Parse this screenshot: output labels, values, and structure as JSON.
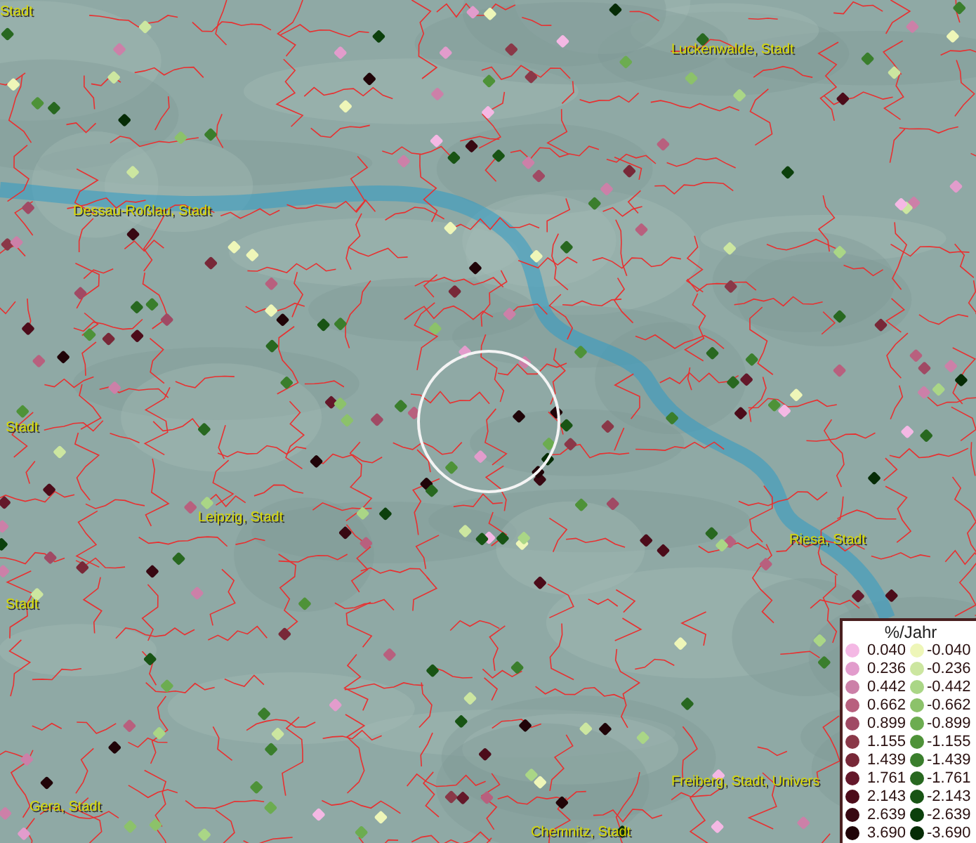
{
  "map": {
    "place_labels": [
      {
        "text": "Stadt"
      },
      {
        "text": "Luckenwalde, Stadt"
      },
      {
        "text": "Dessau-Roßlau, Stadt"
      },
      {
        "text": "Stadt"
      },
      {
        "text": "Leipzig, Stadt"
      },
      {
        "text": "Riesa, Stadt"
      },
      {
        "text": "Stadt"
      },
      {
        "text": "Gera, Stadt"
      },
      {
        "text": "Freiberg, Stadt, Univers"
      },
      {
        "text": "Chemnitz, Stadt"
      }
    ]
  },
  "legend": {
    "title": "%/Jahr",
    "rows": [
      {
        "left": {
          "value": "0.040",
          "color": "#f4b8e4"
        },
        "right": {
          "value": "-0.040",
          "color": "#eef6b8"
        }
      },
      {
        "left": {
          "value": "0.236",
          "color": "#e29ccc"
        },
        "right": {
          "value": "-0.236",
          "color": "#cce6a0"
        }
      },
      {
        "left": {
          "value": "0.442",
          "color": "#cc80a8"
        },
        "right": {
          "value": "-0.442",
          "color": "#aad686"
        }
      },
      {
        "left": {
          "value": "0.662",
          "color": "#b8607e"
        },
        "right": {
          "value": "-0.662",
          "color": "#8cc26a"
        }
      },
      {
        "left": {
          "value": "0.899",
          "color": "#a04a64"
        },
        "right": {
          "value": "-0.899",
          "color": "#6cac50"
        }
      },
      {
        "left": {
          "value": "1.155",
          "color": "#8a3848"
        },
        "right": {
          "value": "-1.155",
          "color": "#4e9238"
        }
      },
      {
        "left": {
          "value": "1.439",
          "color": "#782838"
        },
        "right": {
          "value": "-1.439",
          "color": "#3a7e2c"
        }
      },
      {
        "left": {
          "value": "1.761",
          "color": "#64182a"
        },
        "right": {
          "value": "-1.761",
          "color": "#286820"
        }
      },
      {
        "left": {
          "value": "2.143",
          "color": "#4c0c1a"
        },
        "right": {
          "value": "-2.143",
          "color": "#185414"
        }
      },
      {
        "left": {
          "value": "2.639",
          "color": "#380812"
        },
        "right": {
          "value": "-2.639",
          "color": "#0c400c"
        }
      },
      {
        "left": {
          "value": "3.690",
          "color": "#200408"
        },
        "right": {
          "value": "-3.690",
          "color": "#062c06"
        }
      }
    ]
  }
}
